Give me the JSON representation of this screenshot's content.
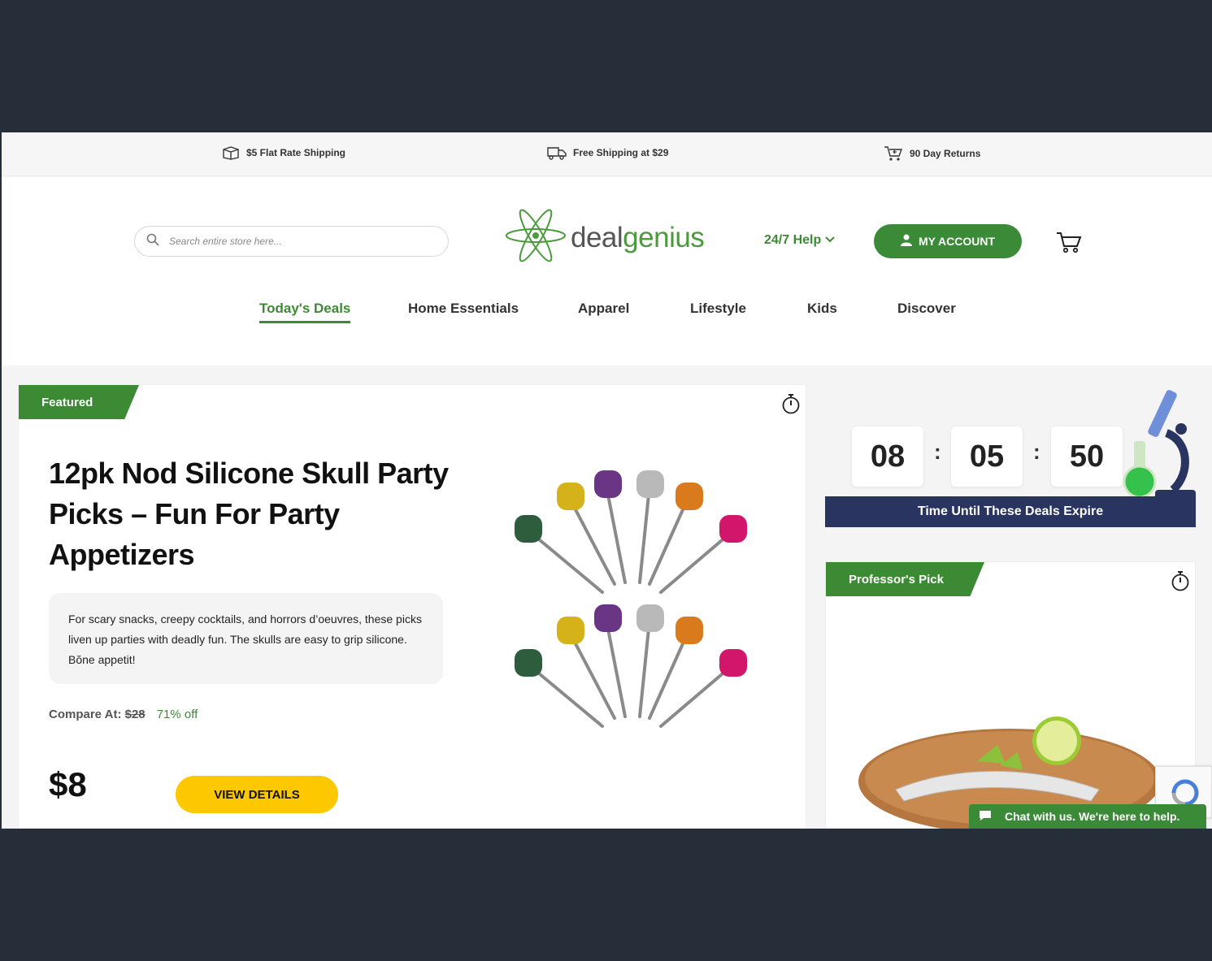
{
  "promo": [
    {
      "label": "$5 Flat Rate Shipping",
      "icon": "box-icon"
    },
    {
      "label": "Free Shipping at $29",
      "icon": "truck-icon"
    },
    {
      "label": "90 Day Returns",
      "icon": "return-cart-icon"
    }
  ],
  "header": {
    "search_placeholder": "Search entire store here...",
    "logo_part1": "deal",
    "logo_part2": "genius",
    "help_label": "24/7 Help",
    "account_label": "MY ACCOUNT"
  },
  "nav": [
    {
      "label": "Today's Deals",
      "active": true
    },
    {
      "label": "Home Essentials"
    },
    {
      "label": "Apparel"
    },
    {
      "label": "Lifestyle"
    },
    {
      "label": "Kids"
    },
    {
      "label": "Discover"
    }
  ],
  "featured": {
    "tag": "Featured",
    "title": "12pk Nod Silicone Skull Party Picks – Fun For Party Appetizers",
    "description": "For scary snacks, creepy cocktails, and horrors d’oeuvres, these picks liven up parties with deadly fun. The skulls are easy to grip silicone. Bŏne appetit!",
    "compare_label": "Compare At:",
    "compare_price": "$28",
    "discount": "71% off",
    "price": "$8",
    "cta": "VIEW DETAILS"
  },
  "countdown": {
    "hours": "08",
    "minutes": "05",
    "seconds": "50",
    "separator": ":",
    "label": "Time Until These Deals Expire"
  },
  "professor": {
    "tag": "Professor's Pick"
  },
  "chat": {
    "label": "Chat with us. We're here to help."
  },
  "colors": {
    "brand_green": "#3d8a35",
    "navy": "#2a3460",
    "cta_yellow": "#fdc800"
  }
}
